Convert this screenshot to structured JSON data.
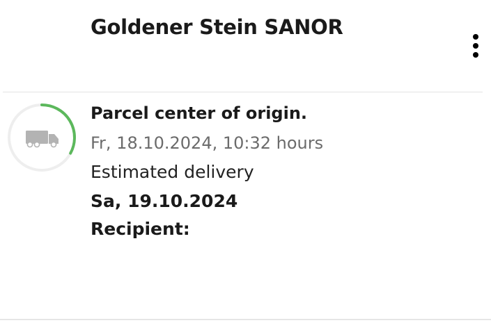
{
  "header": {
    "title": "Goldener Stein SANOR",
    "menu_icon": "more-vertical-icon"
  },
  "shipment": {
    "status_icon": "delivery-truck-icon",
    "progress_fraction": 0.33,
    "colors": {
      "progress": "#5cb85c",
      "track": "#eeeeee",
      "truck": "#b3b3b3"
    },
    "status_title": "Parcel center of origin.",
    "status_timestamp": "Fr, 18.10.2024, 10:32 hours",
    "delivery_label": "Estimated delivery",
    "delivery_date": "Sa, 19.10.2024",
    "recipient_label": "Recipient:"
  }
}
